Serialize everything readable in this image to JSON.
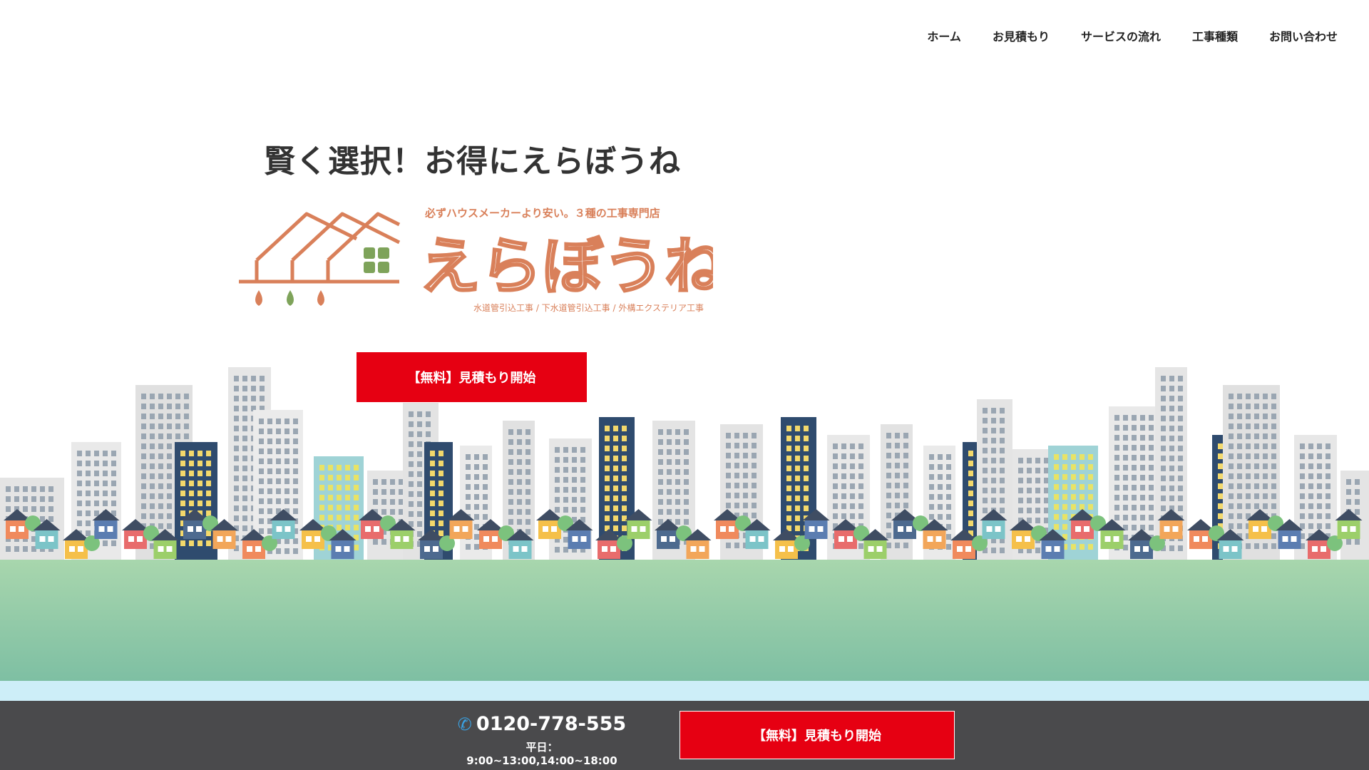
{
  "nav": {
    "items": [
      "ホーム",
      "お見積もり",
      "サービスの流れ",
      "工事種類",
      "お問い合わせ"
    ]
  },
  "hero": {
    "title": "賢く選択！お得にえらぼうね",
    "tagline": "必ずハウスメーカーより安い。３種の工事専門店",
    "logo_text": "えらぼうね",
    "services": "水道管引込工事 / 下水道管引込工事 / 外構エクステリア工事",
    "cta_label": "【無料】見積もり開始"
  },
  "footer_bar": {
    "phone": "0120-778-555",
    "hours": "平日：9:00~13:00,14:00~18:00",
    "cta_label": "【無料】見積もり開始"
  },
  "icons": {
    "phone": "phone-icon",
    "logo": "house-logo-icon"
  },
  "colors": {
    "accent": "#e60012",
    "logo": "#d9805a",
    "bar": "#4a4a4c",
    "ground": "#a8d6ad"
  }
}
